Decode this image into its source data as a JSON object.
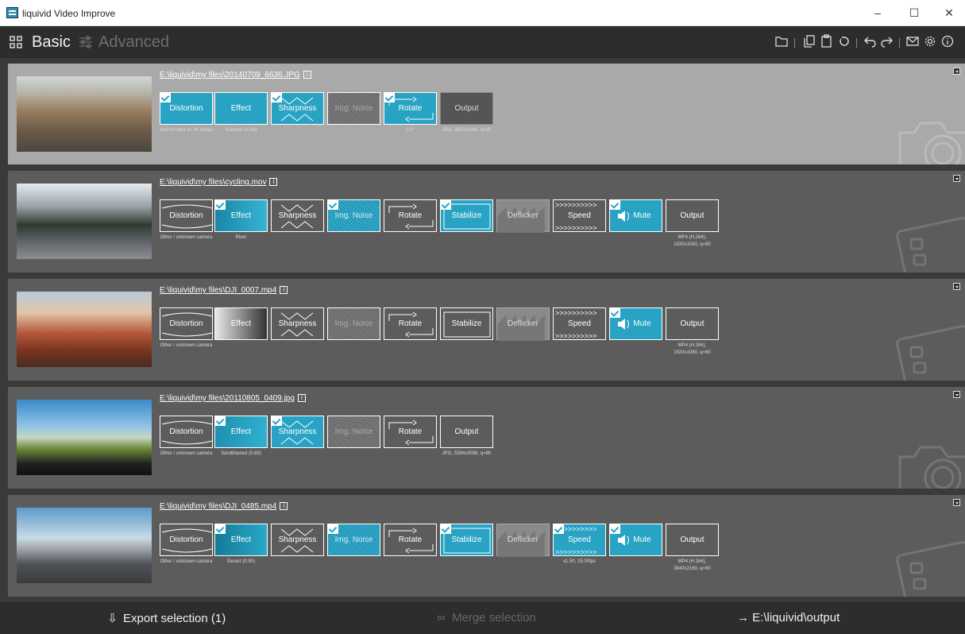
{
  "window": {
    "title": "liquivid Video Improve",
    "minimize": "–",
    "maximize": "☐",
    "close": "✕"
  },
  "toolbar": {
    "basic": "Basic",
    "advanced": "Advanced"
  },
  "rows": [
    {
      "path": "E:\\liquivid\\my files\\20140709_6636.JPG",
      "info": "i",
      "tiles": {
        "distortion": "Distortion",
        "effect": "Effect",
        "sharpness": "Sharpness",
        "noise": "Img. Noise",
        "rotate": "Rotate",
        "output": "Output"
      },
      "subs": {
        "distortion": "GoPro Hero 3+ W (wide)",
        "effect": "Summer (0.64)",
        "rotate": "1.0°",
        "output": "JPG, 3920x2160, q=85"
      }
    },
    {
      "path": "E:\\liquivid\\my files\\cycling.mov",
      "info": "i",
      "tiles": {
        "distortion": "Distortion",
        "effect": "Effect",
        "sharpness": "Sharpness",
        "noise": "Img. Noise",
        "rotate": "Rotate",
        "stabilize": "Stabilize",
        "deflicker": "Deflicker",
        "speed": "Speed",
        "mute": "Mute",
        "output": "Output"
      },
      "subs": {
        "distortion": "Other / unknown camera",
        "effect": "River",
        "output": "MP4 (H.264), 1920x1080, q=90"
      }
    },
    {
      "path": "E:\\liquivid\\my files\\DJI_0007.mp4",
      "info": "i",
      "tiles": {
        "distortion": "Distortion",
        "effect": "Effect",
        "sharpness": "Sharpness",
        "noise": "Img. Noise",
        "rotate": "Rotate",
        "stabilize": "Stabilize",
        "deflicker": "Deflicker",
        "speed": "Speed",
        "mute": "Mute",
        "output": "Output"
      },
      "subs": {
        "distortion": "Other / unknown camera",
        "output": "MP4 (H.264), 1920x1080, q=90"
      }
    },
    {
      "path": "E:\\liquivid\\my files\\20110805_0409.jpg",
      "info": "i",
      "tiles": {
        "distortion": "Distortion",
        "effect": "Effect",
        "sharpness": "Sharpness",
        "noise": "Img. Noise",
        "rotate": "Rotate",
        "output": "Output"
      },
      "subs": {
        "distortion": "Other / unknown camera",
        "effect": "Sandblasted (0.69)",
        "output": "JPG, 5394x3596, q=90"
      }
    },
    {
      "path": "E:\\liquivid\\my files\\DJI_0485.mp4",
      "info": "i",
      "tiles": {
        "distortion": "Distortion",
        "effect": "Effect",
        "sharpness": "Sharpness",
        "noise": "Img. Noise",
        "rotate": "Rotate",
        "stabilize": "Stabilize",
        "deflicker": "Deflicker",
        "speed": "Speed",
        "mute": "Mute",
        "output": "Output"
      },
      "subs": {
        "distortion": "Other / unknown camera",
        "effect": "Desert (0.90)",
        "speed": "x1.50, 25.00fps",
        "output": "MP4 (H.264), 3840x2160, q=90"
      }
    }
  ],
  "bottom": {
    "export": "Export selection (1)",
    "merge": "Merge selection",
    "output": "→ E:\\liquivid\\output"
  },
  "colors": {
    "accent": "#29a3c4",
    "toolbar": "#2d2d2d",
    "row": "#5c5c5c",
    "row_selected": "#a9a9a9"
  },
  "icons": [
    "grid-icon",
    "sliders-icon",
    "folder-icon",
    "copy-icon",
    "paste-icon",
    "reset-icon",
    "undo-icon",
    "redo-icon",
    "email-icon",
    "gear-icon",
    "about-icon",
    "info-icon",
    "camera-icon",
    "film-icon",
    "speaker-icon"
  ]
}
